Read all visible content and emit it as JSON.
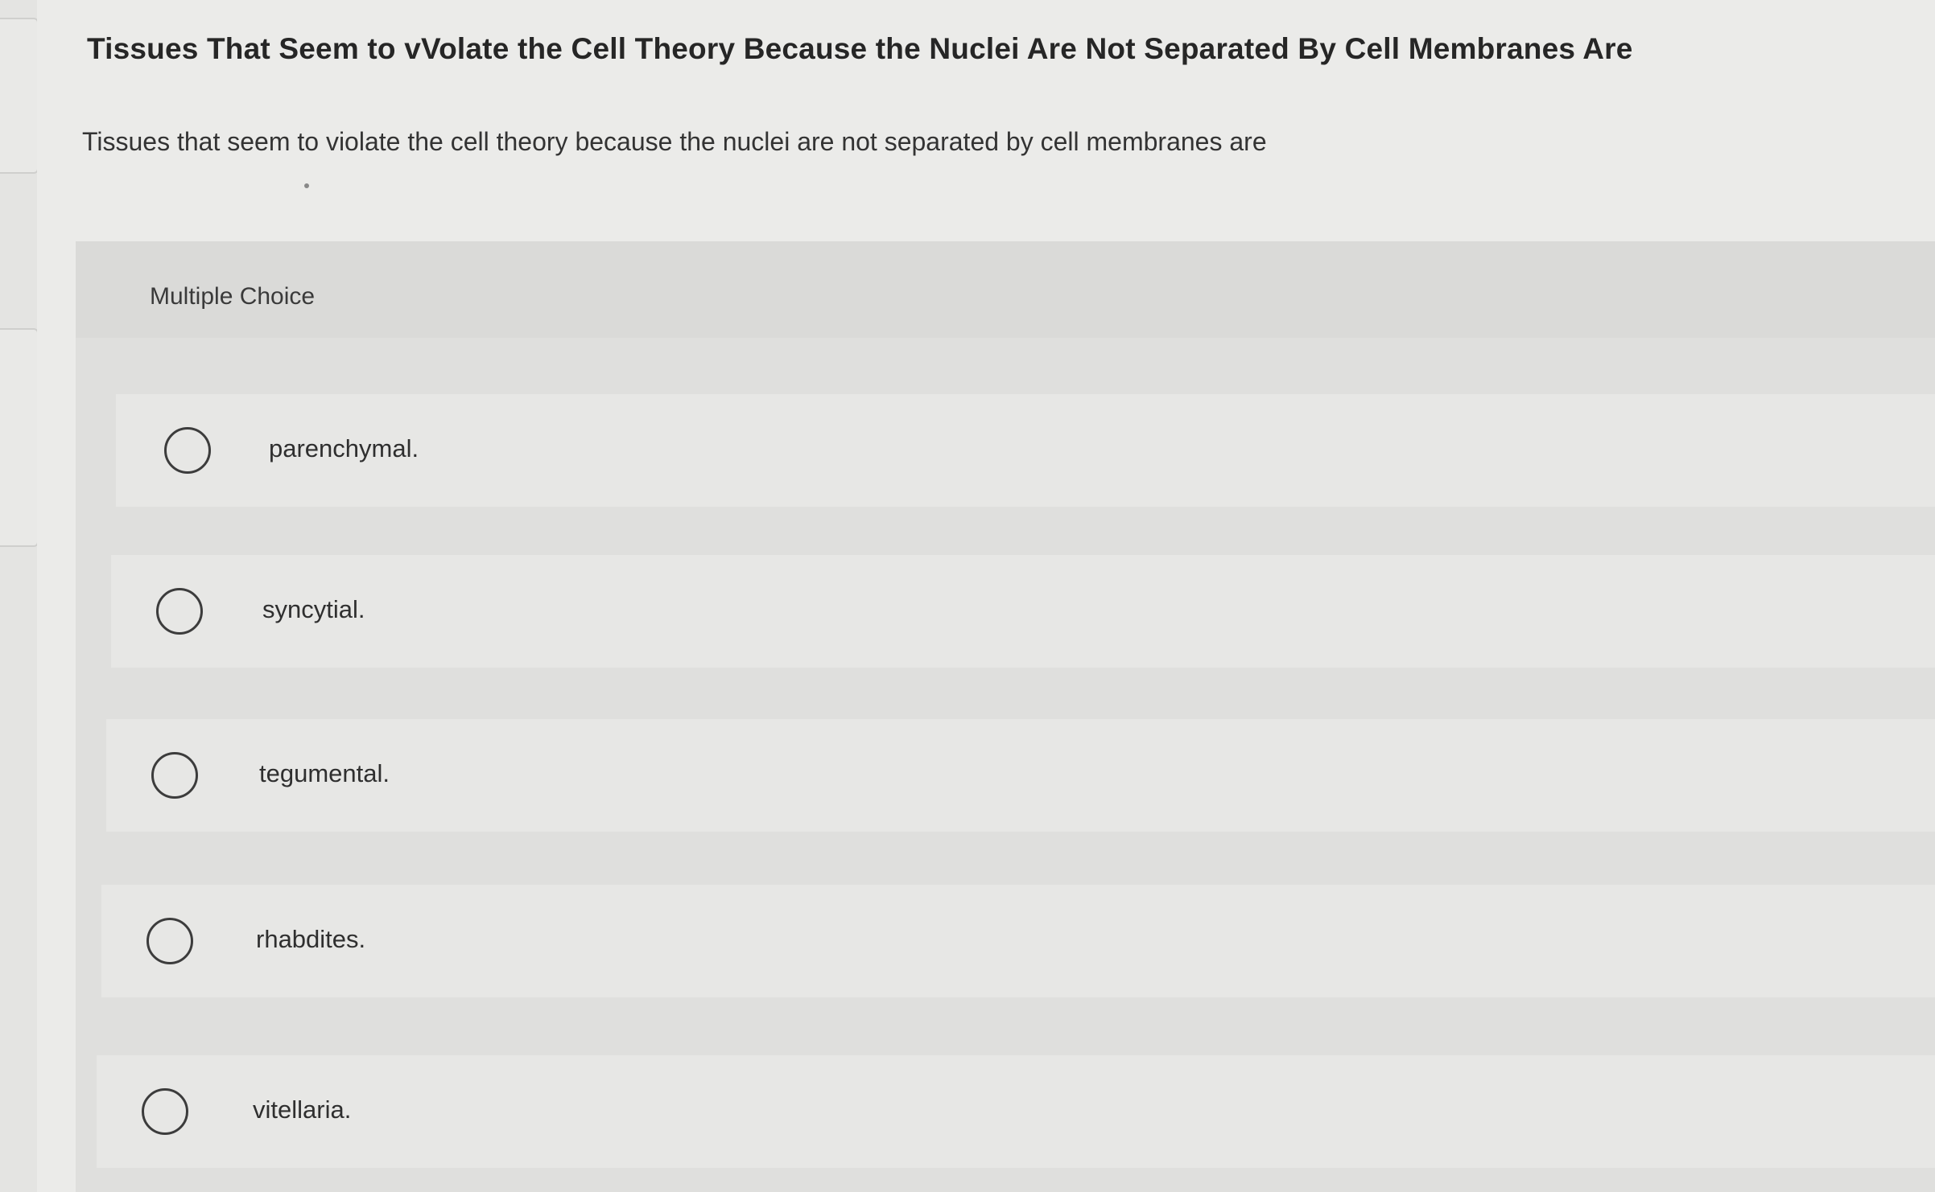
{
  "question": {
    "title": "Tissues That Seem to vVolate the Cell Theory Because the Nuclei Are Not Separated By Cell Membranes Are",
    "prompt": "Tissues that seem to violate the cell theory because the nuclei are not separated by cell membranes are"
  },
  "multiple_choice": {
    "label": "Multiple Choice",
    "options": [
      {
        "label": "parenchymal."
      },
      {
        "label": "syncytial."
      },
      {
        "label": "tegumental."
      },
      {
        "label": "rhabdites."
      },
      {
        "label": "vitellaria."
      }
    ]
  }
}
